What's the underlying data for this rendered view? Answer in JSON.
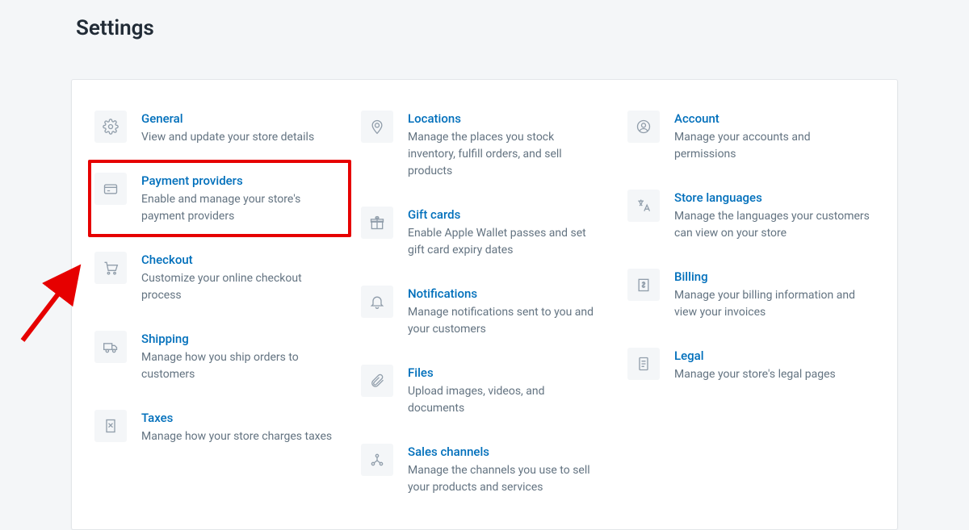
{
  "page": {
    "title": "Settings"
  },
  "items": {
    "general": {
      "title": "General",
      "desc": "View and update your store details",
      "icon": "gear-icon"
    },
    "payments": {
      "title": "Payment providers",
      "desc": "Enable and manage your store's payment providers",
      "icon": "card-icon",
      "highlighted": true
    },
    "checkout": {
      "title": "Checkout",
      "desc": "Customize your online checkout process",
      "icon": "cart-icon"
    },
    "shipping": {
      "title": "Shipping",
      "desc": "Manage how you ship orders to customers",
      "icon": "truck-icon"
    },
    "taxes": {
      "title": "Taxes",
      "desc": "Manage how your store charges taxes",
      "icon": "receipt-icon"
    },
    "locations": {
      "title": "Locations",
      "desc": "Manage the places you stock inventory, fulfill orders, and sell products",
      "icon": "location-icon"
    },
    "giftcards": {
      "title": "Gift cards",
      "desc": "Enable Apple Wallet passes and set gift card expiry dates",
      "icon": "gift-icon"
    },
    "notifications": {
      "title": "Notifications",
      "desc": "Manage notifications sent to you and your customers",
      "icon": "bell-icon"
    },
    "files": {
      "title": "Files",
      "desc": "Upload images, videos, and documents",
      "icon": "clip-icon"
    },
    "channels": {
      "title": "Sales channels",
      "desc": "Manage the channels you use to sell your products and services",
      "icon": "channels-icon"
    },
    "account": {
      "title": "Account",
      "desc": "Manage your accounts and permissions",
      "icon": "user-icon"
    },
    "languages": {
      "title": "Store languages",
      "desc": "Manage the languages your customers can view on your store",
      "icon": "translate-icon"
    },
    "billing": {
      "title": "Billing",
      "desc": "Manage your billing information and view your invoices",
      "icon": "billing-icon"
    },
    "legal": {
      "title": "Legal",
      "desc": "Manage your store's legal pages",
      "icon": "legal-icon"
    }
  },
  "annotation": {
    "arrow_points_to": "payments"
  }
}
